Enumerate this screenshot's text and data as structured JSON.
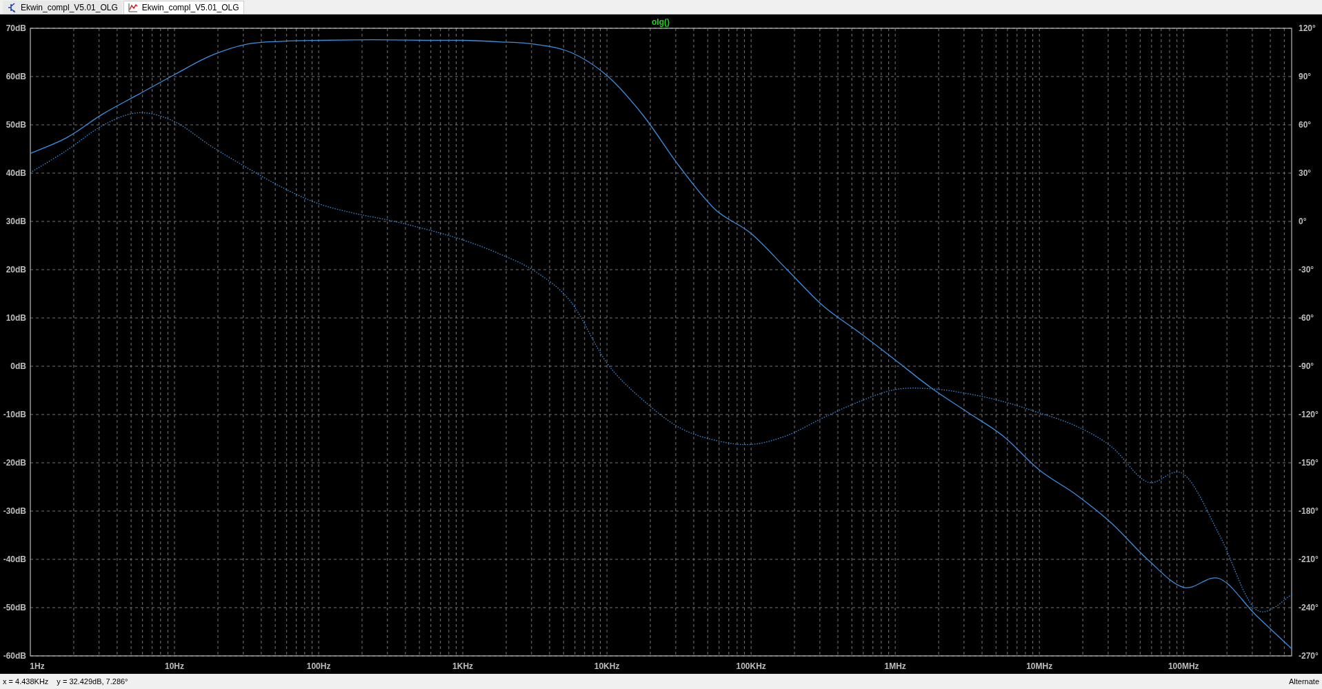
{
  "tabs": [
    {
      "label": "Ekwin_compl_V5.01_OLG",
      "kind": "schematic",
      "selected": false
    },
    {
      "label": "Ekwin_compl_V5.01_OLG",
      "kind": "waveform",
      "selected": true
    }
  ],
  "plot": {
    "magnitude": {
      "chart_data": {
        "type": "line",
        "title": "olg()",
        "grid": true,
        "ylim": [
          -60,
          70
        ],
        "categories": [
          "1Hz",
          null,
          null,
          null,
          "10Hz",
          null,
          null,
          null,
          "100Hz",
          null,
          null,
          null,
          "1KHz",
          null,
          null,
          null,
          "10KHz",
          null,
          null,
          null,
          "100KHz",
          null,
          null,
          null,
          "1MHz",
          null,
          null,
          null,
          "10MHz",
          null,
          null,
          null,
          "100MHz",
          null,
          null,
          null
        ],
        "series": [
          {
            "color": "#3d8fe0",
            "values": [
              44.1,
              47.3,
              52.2,
              56.3,
              60.4,
              64.3,
              66.7,
              67.3,
              67.5,
              67.6,
              67.6,
              67.5,
              67.5,
              67.2,
              66.7,
              65,
              60.2,
              52,
              41.5,
              32.5,
              27.5,
              20,
              12.5,
              7,
              1.3,
              -4.5,
              -9.5,
              -14.5,
              -21.5,
              -26.5,
              -32.5,
              -40,
              -45.8,
              -44,
              -51.5,
              -58.5
            ]
          }
        ],
        "yticks": [
          {
            "value": 70,
            "label": "70dB"
          },
          {
            "value": 60,
            "label": "60dB"
          },
          {
            "value": 50,
            "label": "50dB"
          },
          {
            "value": 40,
            "label": "40dB"
          },
          {
            "value": 30,
            "label": "30dB"
          },
          {
            "value": 20,
            "label": "20dB"
          },
          {
            "value": 10,
            "label": "10dB"
          },
          {
            "value": 0,
            "label": "0dB"
          },
          {
            "value": -10,
            "label": "-10dB"
          },
          {
            "value": -20,
            "label": "-20dB"
          },
          {
            "value": -30,
            "label": "-30dB"
          },
          {
            "value": -40,
            "label": "-40dB"
          },
          {
            "value": -50,
            "label": "-50dB"
          },
          {
            "value": -60,
            "label": "-60dB"
          }
        ]
      }
    },
    "phase": {
      "chart_data": {
        "type": "line",
        "ylim": [
          -270,
          120
        ],
        "series": [
          {
            "color": "#3d8fe0",
            "line_style": "dotted",
            "values": [
              30.3,
              44,
              59.5,
              67.5,
              62,
              47,
              33.5,
              21,
              11,
              5,
              0.5,
              -5,
              -11.5,
              -20,
              -31,
              -50,
              -88,
              -111,
              -128,
              -136,
              -138.6,
              -133,
              -122,
              -112,
              -104.5,
              -104,
              -107,
              -112,
              -119,
              -127,
              -140,
              -162,
              -157,
              -195,
              -241,
              -232
            ]
          }
        ],
        "yticks": [
          {
            "value": 120,
            "label": "120°"
          },
          {
            "value": 90,
            "label": "90°"
          },
          {
            "value": 60,
            "label": "60°"
          },
          {
            "value": 30,
            "label": "30°"
          },
          {
            "value": 0,
            "label": "0°"
          },
          {
            "value": -30,
            "label": "-30°"
          },
          {
            "value": -60,
            "label": "-60°"
          },
          {
            "value": -90,
            "label": "-90°"
          },
          {
            "value": -120,
            "label": "-120°"
          },
          {
            "value": -150,
            "label": "-150°"
          },
          {
            "value": -180,
            "label": "-180°"
          },
          {
            "value": -210,
            "label": "-210°"
          },
          {
            "value": -240,
            "label": "-240°"
          },
          {
            "value": -270,
            "label": "-270°"
          }
        ]
      }
    }
  },
  "status_bar": {
    "cursor_x": "x = 4.438KHz",
    "cursor_y": "y = 32.429dB, 7.286°",
    "mode": "Alternate"
  }
}
